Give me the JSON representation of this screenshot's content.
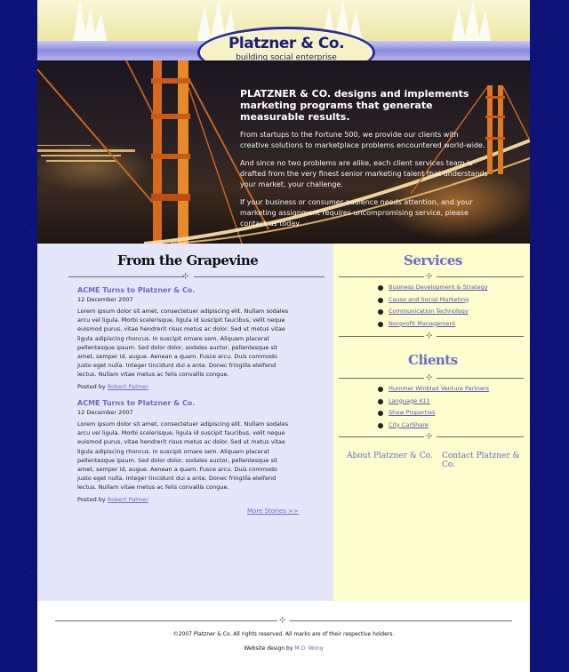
{
  "brand": {
    "name": "Platzner & Co.",
    "tagline": "building social enterprise"
  },
  "hero": {
    "headline": "PLATZNER & CO. designs and implements marketing programs that generate measurable results.",
    "paragraphs": [
      "From startups to the Fortune 500, we provide our clients with creative solutions to marketplace problems encountered world-wide.",
      "And since no two problems are alike, each client services team is drafted from the very finest senior marketing talent that understands your market, your challenge.",
      "If your business or consumer audience needs attention, and your marketing assignment requires uncompromising service, please contact us today."
    ]
  },
  "grapevine": {
    "title": "From the Grapevine",
    "articles": [
      {
        "title": "ACME Turns to Platzner & Co.",
        "date": "12 December 2007",
        "body": "Lorem ipsum dolor sit amet, consectetuer adipiscing elit. Nullam sodales arcu vel ligula. Morbi scelerisque, ligula id suscipit faucibus, velit neque euismod purus, vitae hendrerit risus metus ac dolor. Sed ut metus vitae ligula adipiscing rhoncus. In suscipit ornare sem. Aliquam placerat pellentesque ipsum. Sed dolor dolor, sodales auctor, pellentesque sit amet, semper id, augue. Aenean a quam. Fusce arcu. Duis commodo justo eget nulla. Integer tincidunt dui a ante. Donec fringilla eleifend lectus. Nullam vitae metus ac felis convallis congue.",
        "posted_by_label": "Posted by",
        "author": "Robert Palmer"
      },
      {
        "title": "ACME Turns to Platzner & Co.",
        "date": "12 December 2007",
        "body": "Lorem ipsum dolor sit amet, consectetuer adipiscing elit. Nullam sodales arcu vel ligula. Morbi scelerisque, ligula id suscipit faucibus, velit neque euismod purus, vitae hendrerit risus metus ac dolor. Sed ut metus vitae ligula adipiscing rhoncus. In suscipit ornare sem. Aliquam placerat pellentesque ipsum. Sed dolor dolor, sodales auctor, pellentesque sit amet, semper id, augue. Aenean a quam. Fusce arcu. Duis commodo justo eget nulla. Integer tincidunt dui a ante. Donec fringilla eleifend lectus. Nullam vitae metus ac felis convallis congue.",
        "posted_by_label": "Posted by",
        "author": "Robert Palmer"
      }
    ],
    "more_link": "More Stories >>"
  },
  "services": {
    "title": "Services",
    "items": [
      "Business Development & Strategy",
      "Cause and Social Marketing",
      "Communication Technology",
      "Nonprofit Management"
    ]
  },
  "clients": {
    "title": "Clients",
    "items": [
      "Hummer Winblad Venture Partners",
      "Language 411",
      "Shaw Properties",
      "City CarShare"
    ]
  },
  "bottom_links": {
    "about": "About Platzner & Co.",
    "contact": "Contact Platzner & Co."
  },
  "footer": {
    "copyright": "©2007 Platzner & Co.  All rights reserved.  All marks are of their respective holders.",
    "credit_prefix": "Website design by",
    "credit_name": "M.O. Wong"
  },
  "ornament_glyph": "⊹",
  "colors": {
    "page_bg": "#0a0f7a",
    "left_col": "#e6e6fa",
    "right_col": "#fdfdce",
    "link": "#6b6bc8",
    "brand_navy": "#1b1f7a"
  }
}
